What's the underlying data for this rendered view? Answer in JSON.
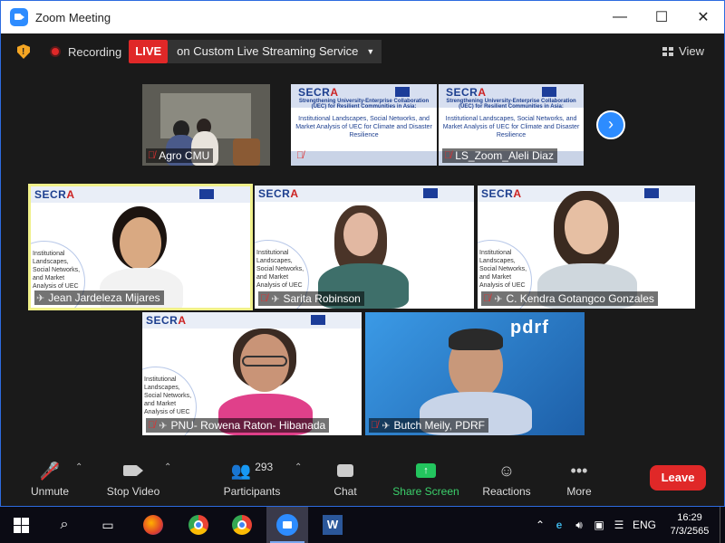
{
  "window": {
    "title": "Zoom Meeting",
    "minimize": "—",
    "maximize": "☐",
    "close": "✕"
  },
  "infobar": {
    "recording_label": "Recording",
    "live_label": "LIVE",
    "stream_service": "on Custom Live Streaming Service",
    "view_label": "View"
  },
  "top_strip": [
    {
      "name": "Agro CMU"
    },
    {
      "name": ""
    },
    {
      "name": "LS_Zoom_Aleli Diaz"
    }
  ],
  "shared_slide": {
    "title": "Strengthening University-Enterprise Collaboration (UEC) for Resilient Communities in Asia:",
    "subtitle": "Institutional Landscapes, Social Networks, and Market Analysis of UEC for Climate and Disaster Resilience"
  },
  "slide_brand": {
    "secra_prefix": "SECR",
    "secra_suffix": "A",
    "body_text": "Institutional Landscapes, Social Networks, and Market Analysis of UEC"
  },
  "gallery": [
    {
      "name": "Jean Jardeleza Mijares"
    },
    {
      "name": "Sarita Robinson"
    },
    {
      "name": "C. Kendra Gotangco Gonzales"
    },
    {
      "name": "PNU- Rowena Raton- Hibanada"
    },
    {
      "name": "Butch Meily, PDRF"
    }
  ],
  "pdrf_logo": "pdrf",
  "toolbar": {
    "unmute": "Unmute",
    "stop_video": "Stop Video",
    "participants": "Participants",
    "participants_count": "293",
    "chat": "Chat",
    "share_screen": "Share Screen",
    "reactions": "Reactions",
    "more": "More",
    "leave": "Leave"
  },
  "taskbar": {
    "lang": "ENG",
    "time": "16:29",
    "date": "7/3/2565"
  },
  "colors": {
    "accent": "#2d8cff",
    "live_red": "#e02828",
    "share_green": "#23c55e",
    "active_speaker": "#f0f08a"
  }
}
